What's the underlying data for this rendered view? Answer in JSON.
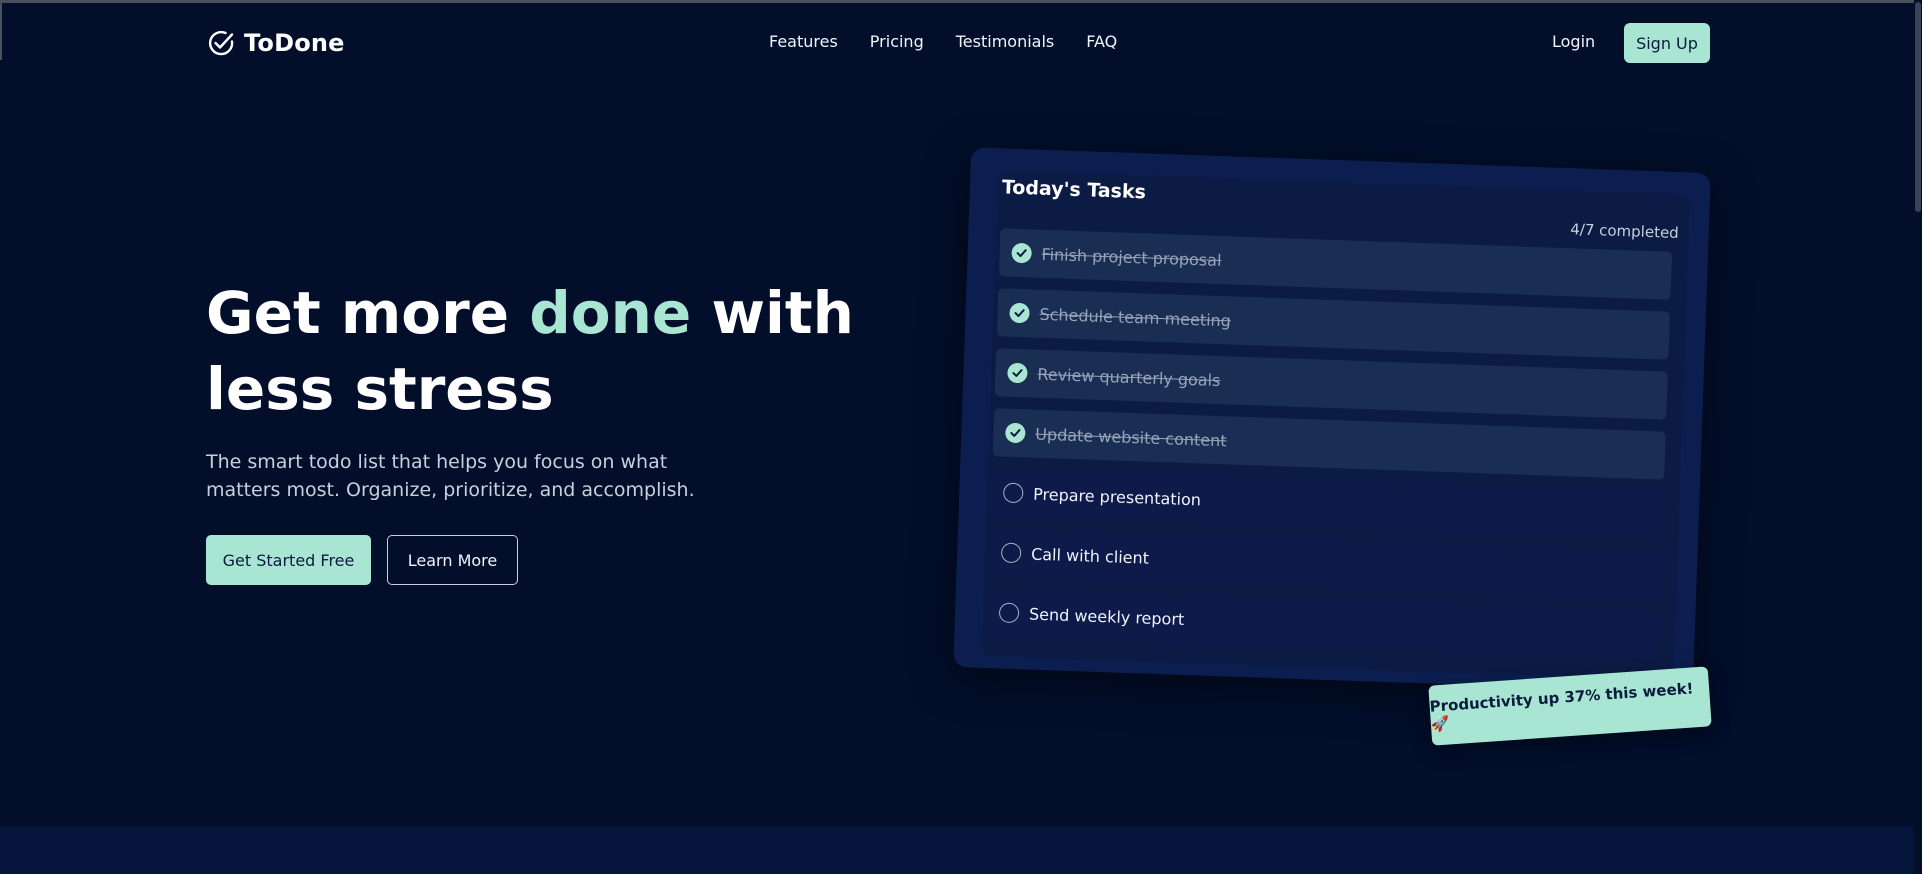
{
  "brand": {
    "name": "ToDone",
    "accent": "#a8e6d3",
    "background": "#020e2a"
  },
  "nav": {
    "links": [
      "Features",
      "Pricing",
      "Testimonials",
      "FAQ"
    ],
    "login": "Login",
    "signup": "Sign Up"
  },
  "hero": {
    "title_before": "Get more ",
    "title_accent": "done",
    "title_after": " with less stress",
    "subtitle": "The smart todo list that helps you focus on what matters most. Organize, prioritize, and accomplish.",
    "primary_cta": "Get Started Free",
    "secondary_cta": "Learn More"
  },
  "tasks_card": {
    "title": "Today's Tasks",
    "count": "4/7 completed",
    "items": [
      {
        "label": "Finish project proposal",
        "done": true
      },
      {
        "label": "Schedule team meeting",
        "done": true
      },
      {
        "label": "Review quarterly goals",
        "done": true
      },
      {
        "label": "Update website content",
        "done": true
      },
      {
        "label": "Prepare presentation",
        "done": false
      },
      {
        "label": "Call with client",
        "done": false
      },
      {
        "label": "Send weekly report",
        "done": false
      }
    ]
  },
  "badge": {
    "text": "Productivity up 37% this week! 🚀"
  },
  "icons": {
    "logo": "check-circle-icon",
    "task_done": "check-circle-icon",
    "task_open": "empty-circle-icon"
  }
}
